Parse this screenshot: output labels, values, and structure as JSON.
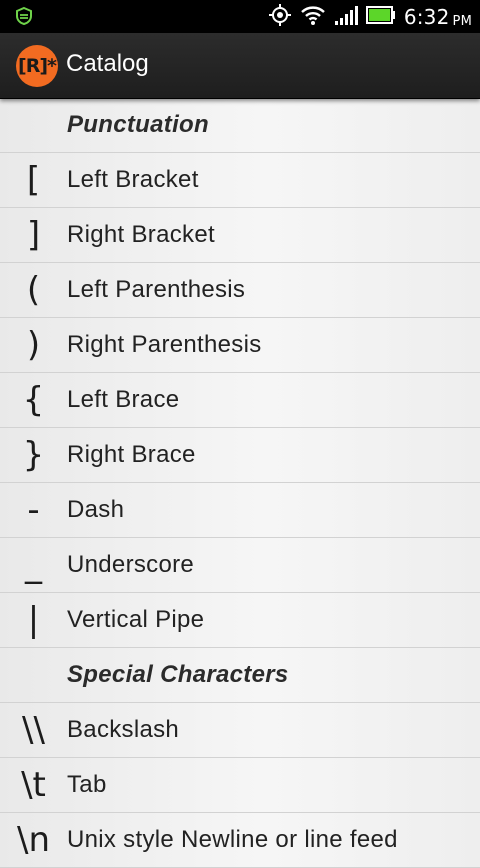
{
  "status_bar": {
    "time": "6:32",
    "ampm": "PM"
  },
  "action_bar": {
    "app_icon_text": "[R]*",
    "title": "Catalog"
  },
  "list": {
    "rows": [
      {
        "type": "header",
        "symbol": "",
        "label": "Punctuation"
      },
      {
        "type": "item",
        "symbol": "[",
        "label": "Left Bracket"
      },
      {
        "type": "item",
        "symbol": "]",
        "label": "Right Bracket"
      },
      {
        "type": "item",
        "symbol": "(",
        "label": "Left Parenthesis"
      },
      {
        "type": "item",
        "symbol": ")",
        "label": "Right Parenthesis"
      },
      {
        "type": "item",
        "symbol": "{",
        "label": "Left Brace"
      },
      {
        "type": "item",
        "symbol": "}",
        "label": "Right Brace"
      },
      {
        "type": "item",
        "symbol": "-",
        "label": "Dash"
      },
      {
        "type": "item",
        "symbol": "_",
        "label": "Underscore"
      },
      {
        "type": "item",
        "symbol": "|",
        "label": "Vertical Pipe"
      },
      {
        "type": "header",
        "symbol": "",
        "label": "Special Characters"
      },
      {
        "type": "item",
        "symbol": "\\\\",
        "label": "Backslash"
      },
      {
        "type": "item",
        "symbol": "\\t",
        "label": "Tab"
      },
      {
        "type": "item",
        "symbol": "\\n",
        "label": "Unix style Newline or line feed"
      }
    ]
  }
}
